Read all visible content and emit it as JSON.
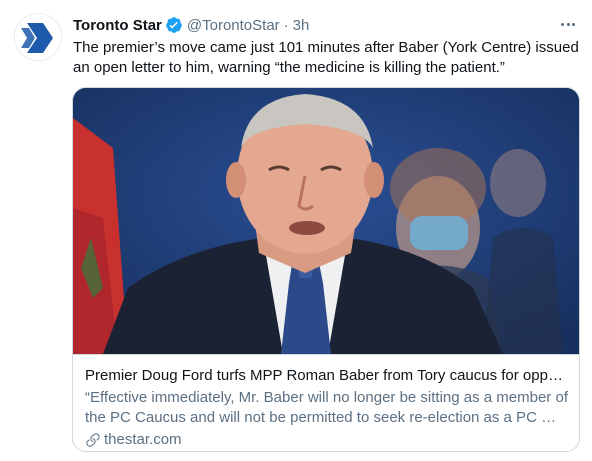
{
  "tweet": {
    "author_name": "Toronto Star",
    "handle": "@TorontoStar",
    "separator": "·",
    "time": "3h",
    "text": "The premier’s move came just 101 minutes after Baber (York Centre) issued an open letter to him, warning “the medicine is killing the patient.”"
  },
  "card": {
    "title": "Premier Doug Ford turfs MPP Roman Baber from Tory caucus for opposi…",
    "description": "“Effective immediately, Mr. Baber will no longer be sitting as a member of the PC Caucus and will not be permitted to seek re-election as a PC …",
    "domain": "thestar.com"
  },
  "icons": {
    "avatar": "toronto-star-logo",
    "verified": "verified-badge-icon",
    "more": "more-options-icon",
    "link": "link-icon"
  },
  "colors": {
    "brand_blue": "#1d5aab",
    "verified_blue": "#1da1f2",
    "secondary_text": "#5b7083",
    "border": "#cfd9de"
  }
}
